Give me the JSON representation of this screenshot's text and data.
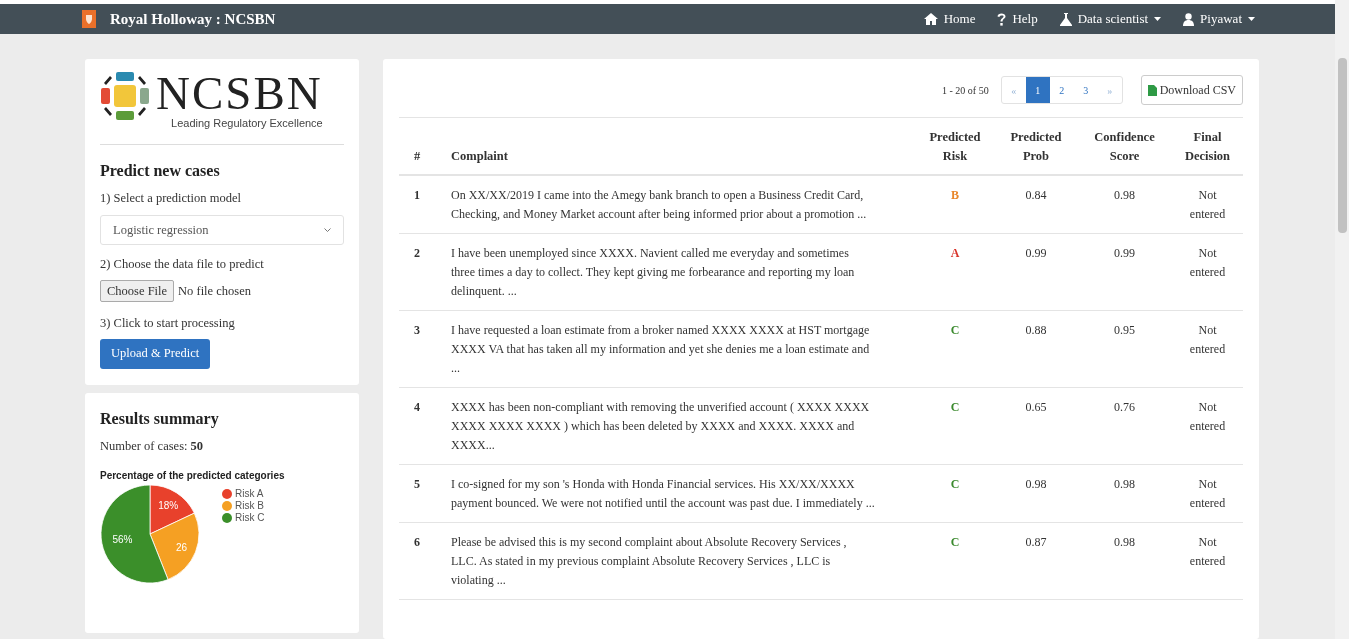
{
  "navbar": {
    "brand": "Royal Holloway : NCSBN",
    "links": [
      {
        "label": "Home",
        "dropdown": false
      },
      {
        "label": "Help",
        "dropdown": false
      },
      {
        "label": "Data scientist",
        "dropdown": true
      },
      {
        "label": "Piyawat",
        "dropdown": true
      }
    ]
  },
  "logo": {
    "name": "NCSBN",
    "tagline": "Leading Regulatory Excellence"
  },
  "predict": {
    "title": "Predict new cases",
    "step1": "1) Select a prediction model",
    "model": "Logistic regression",
    "step2": "2) Choose the data file to predict",
    "file_button": "Choose File",
    "file_status": "No file chosen",
    "step3": "3) Click to start processing",
    "submit": "Upload & Predict"
  },
  "summary": {
    "title": "Results summary",
    "cases_label": "Number of cases:",
    "cases": "50",
    "chart_data": {
      "type": "pie",
      "title": "Percentage of the predicted categories",
      "categories": [
        "Risk A",
        "Risk B",
        "Risk C"
      ],
      "series": [
        {
          "values": [
            18,
            26,
            56
          ]
        }
      ],
      "colors": [
        "#e8412c",
        "#f5a023",
        "#3b8f2a"
      ],
      "value_labels": [
        "18%",
        "26",
        "56%"
      ],
      "legend": true
    }
  },
  "pagination": {
    "range": "1 - 20 of 50",
    "prev": "«",
    "next": "»",
    "pages": [
      {
        "label": "1",
        "selected": true
      },
      {
        "label": "2",
        "selected": false
      },
      {
        "label": "3",
        "selected": false
      }
    ],
    "download": "Download CSV"
  },
  "table": {
    "columns": [
      "#",
      "Complaint",
      "Predicted Risk",
      "Predicted Prob",
      "Confidence Score",
      "Final Decision"
    ],
    "rows": [
      {
        "n": "1",
        "complaint": "On XX/XX/2019 I came into the Amegy bank branch to open a Business Credit Card, Checking, and Money Market account after being informed prior about a promotion ...",
        "risk": "B",
        "color": "#e8862a",
        "prob": "0.84",
        "confidence": "0.98",
        "decision": "Not entered"
      },
      {
        "n": "2",
        "complaint": "I have been unemployed since XXXX. Navient called me everyday and sometimes three times a day to collect. They kept giving me forbearance and reporting my loan delinquent. ...",
        "risk": "A",
        "color": "#d9342b",
        "prob": "0.99",
        "confidence": "0.99",
        "decision": "Not entered"
      },
      {
        "n": "3",
        "complaint": "I have requested a loan estimate from a broker named XXXX XXXX at HST mortgage XXXX VA that has taken all my information and yet she denies me a loan estimate and ...",
        "risk": "C",
        "color": "#3b8a2e",
        "prob": "0.88",
        "confidence": "0.95",
        "decision": "Not entered"
      },
      {
        "n": "4",
        "complaint": "XXXX has been non-compliant with removing the unverified account ( XXXX XXXX XXXX XXXX XXXX ) which has been deleted by XXXX and XXXX. XXXX and XXXX...",
        "risk": "C",
        "color": "#3b8a2e",
        "prob": "0.65",
        "confidence": "0.76",
        "decision": "Not entered"
      },
      {
        "n": "5",
        "complaint": "I co-signed for my son 's Honda with Honda Financial services. His XX/XX/XXXX payment bounced. We were not notified until the account was past due. I immediately ...",
        "risk": "C",
        "color": "#3b8a2e",
        "prob": "0.98",
        "confidence": "0.98",
        "decision": "Not entered"
      },
      {
        "n": "6",
        "complaint": "Please be advised this is my second complaint about Absolute Recovery Services , LLC. As stated in my previous complaint Absolute Recovery Services , LLC is violating ...",
        "risk": "C",
        "color": "#3b8a2e",
        "prob": "0.87",
        "confidence": "0.98",
        "decision": "Not entered"
      }
    ]
  }
}
